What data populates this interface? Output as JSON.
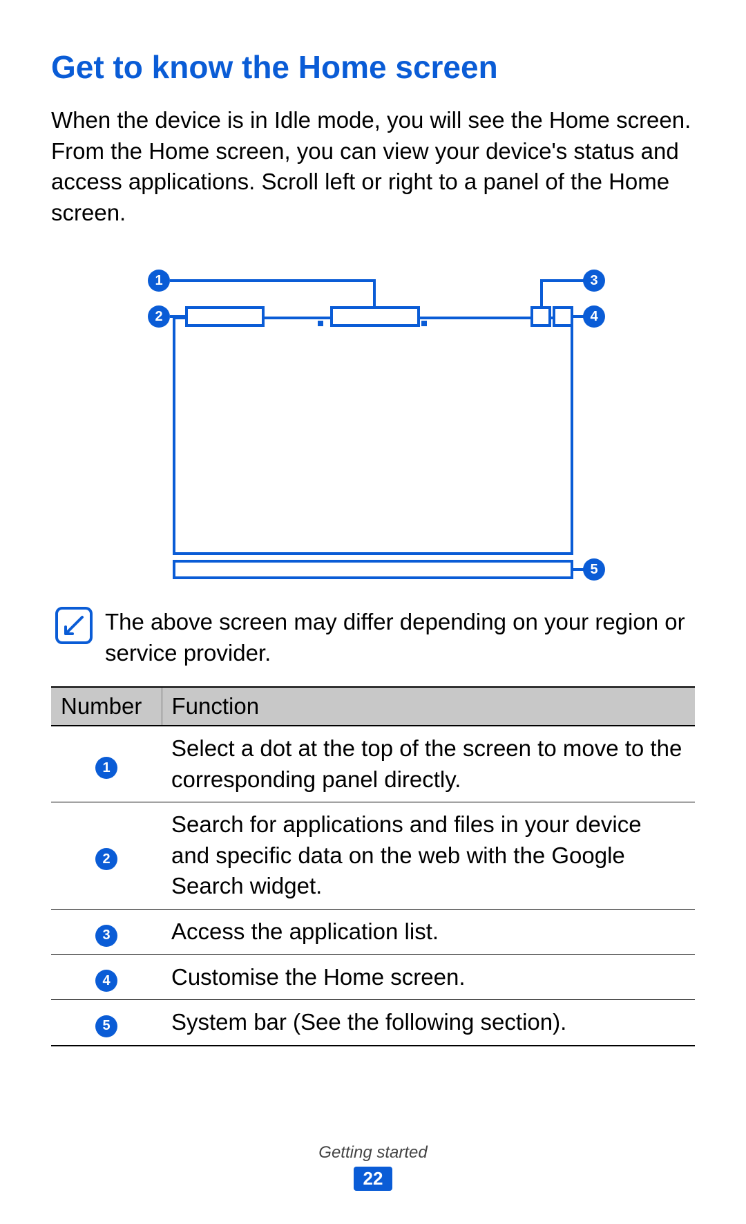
{
  "heading": "Get to know the Home screen",
  "intro": "When the device is in Idle mode, you will see the Home screen. From the Home screen, you can view your device's status and access applications. Scroll left or right to a panel of the Home screen.",
  "diagram": {
    "callouts": [
      "1",
      "2",
      "3",
      "4",
      "5"
    ]
  },
  "note": "The above screen may differ depending on your region or service provider.",
  "table": {
    "headers": {
      "col1": "Number",
      "col2": "Function"
    },
    "rows": [
      {
        "num": "1",
        "func": "Select a dot at the top of the screen to move to the corresponding panel directly."
      },
      {
        "num": "2",
        "func": "Search for applications and files in your device and specific data on the web with the Google Search widget."
      },
      {
        "num": "3",
        "func": "Access the application list."
      },
      {
        "num": "4",
        "func": "Customise the Home screen."
      },
      {
        "num": "5",
        "func": "System bar (See the following section)."
      }
    ]
  },
  "footer": {
    "section": "Getting started",
    "page": "22"
  }
}
